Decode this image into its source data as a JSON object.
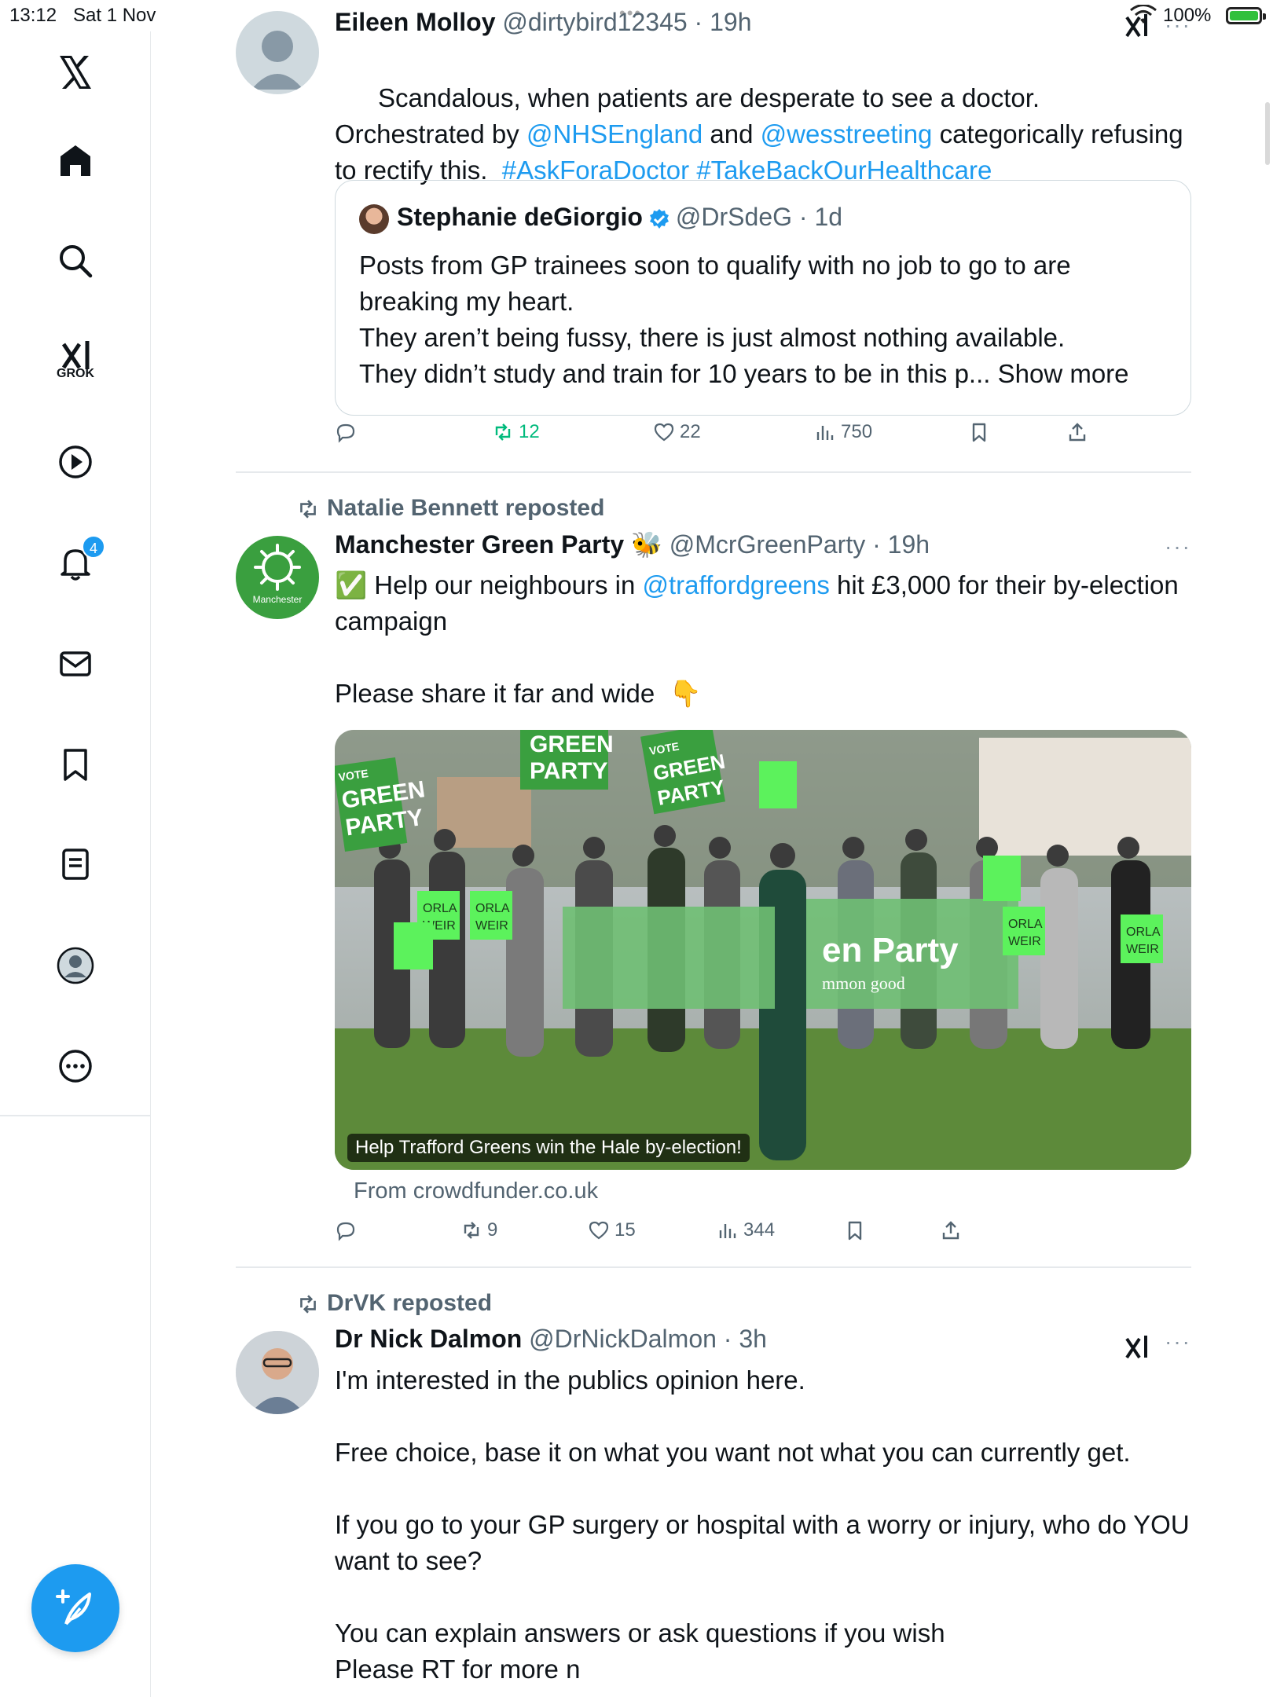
{
  "status_bar": {
    "time": "13:12",
    "date": "Sat 1 Nov",
    "battery_percent": "100%"
  },
  "sidebar": {
    "items": [
      {
        "name": "x-logo"
      },
      {
        "name": "home"
      },
      {
        "name": "search"
      },
      {
        "name": "grok",
        "label": "GROK"
      },
      {
        "name": "video"
      },
      {
        "name": "notifications",
        "badge": "4"
      },
      {
        "name": "messages"
      },
      {
        "name": "bookmarks"
      },
      {
        "name": "lists"
      },
      {
        "name": "profile"
      },
      {
        "name": "more"
      }
    ],
    "compose_icon": "feather-plus-icon"
  },
  "feed": {
    "tweets": [
      {
        "author": "Eileen Molloy",
        "handle": "@dirtybird12345",
        "time": "19h",
        "text_parts": [
          {
            "t": "Scandalous, when patients are desperate to see a doctor. Orchestrated by "
          },
          {
            "t": "@NHSEngland",
            "link": true
          },
          {
            "t": " and "
          },
          {
            "t": "@wesstreeting",
            "link": true
          },
          {
            "t": " categorically refusing to rectify this.  "
          },
          {
            "t": "#AskForaDoctor",
            "link": true
          },
          {
            "t": " "
          },
          {
            "t": "#TakeBackOurHealthcare",
            "link": true
          }
        ],
        "quote": {
          "author": "Stephanie deGiorgio",
          "handle": "@DrSdeG",
          "time": "1d",
          "text": "Posts from GP trainees soon to qualify with no job to go to are breaking my heart.\nThey aren’t being fussy, there is just almost nothing available.\nThey didn’t study and train for 10 years to be in this p... Show more"
        },
        "stats": {
          "retweets": "12",
          "likes": "22",
          "views": "750"
        }
      },
      {
        "reposted_by": "Natalie Bennett reposted",
        "author": "Manchester Green Party",
        "author_emoji": "🐝",
        "handle": "@McrGreenParty",
        "time": "19h",
        "avatar_text": "Manchester",
        "text_parts": [
          {
            "t": "✅ Help our neighbours in "
          },
          {
            "t": "@traffordgreens",
            "link": true
          },
          {
            "t": " hit £3,000 for their by-election campaign\n\nPlease share it far and wide  👇"
          }
        ],
        "media": {
          "caption": "Help Trafford Greens win the Hale by-election!",
          "source": "From crowdfunder.co.uk",
          "signs": [
            "VOTE",
            "GREEN",
            "PARTY",
            "ORLA",
            "WEIR"
          ],
          "banner": "en Party",
          "banner_sub": "mmon good"
        },
        "stats": {
          "retweets": "9",
          "likes": "15",
          "views": "344"
        }
      },
      {
        "reposted_by": "DrVK reposted",
        "author": "Dr Nick Dalmon",
        "handle": "@DrNickDalmon",
        "time": "3h",
        "text": "I'm interested in the publics opinion here.\n\nFree choice, base it on what you want not what you can currently get.\n\nIf you go to your GP surgery or hospital with a worry or injury, who do YOU want to see?\n\nYou can explain answers or ask questions if you wish\nPlease RT for more n"
      }
    ]
  },
  "colors": {
    "accent": "#1d9bf0",
    "retweet_green": "#00ba7c",
    "green_party": "#3a9f3f",
    "text_secondary": "#536471"
  }
}
